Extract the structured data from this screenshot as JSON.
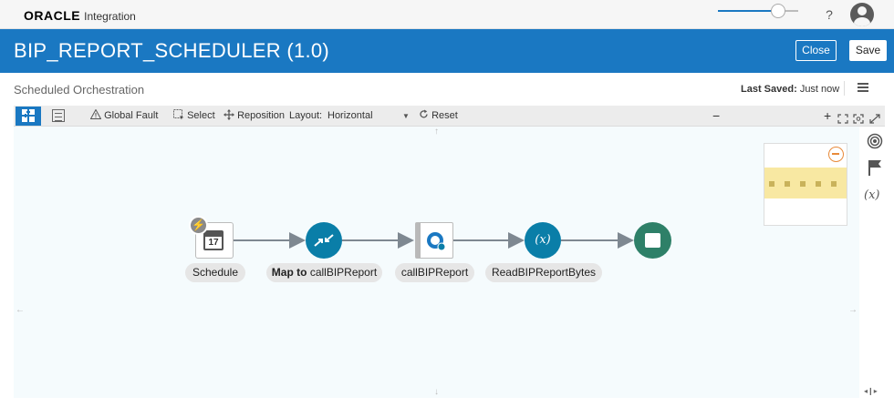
{
  "topbar": {
    "brand": "ORACLE",
    "product": "Integration",
    "help_icon": "?"
  },
  "header": {
    "title": "BIP_REPORT_SCHEDULER (1.0)",
    "close_label": "Close",
    "save_label": "Save"
  },
  "subheader": {
    "title": "Scheduled Orchestration",
    "last_saved_label": "Last Saved:",
    "last_saved_value": "Just now"
  },
  "toolbar": {
    "global_fault": "Global Fault",
    "select": "Select",
    "reposition": "Reposition",
    "layout_label": "Layout:",
    "layout_value": "Horizontal",
    "reset": "Reset",
    "zoom_minus": "−",
    "zoom_plus": "+",
    "zoom_level": 0.75
  },
  "flow": {
    "nodes": [
      {
        "id": "schedule",
        "label": "Schedule",
        "icon": "calendar-icon",
        "calendar_day": "17"
      },
      {
        "id": "map",
        "label_bold": "Map to",
        "label": "callBIPReport",
        "icon": "map-arrows-icon"
      },
      {
        "id": "invoke",
        "label": "callBIPReport",
        "icon": "invoke-adapter-icon"
      },
      {
        "id": "assign",
        "label": "ReadBIPReportBytes",
        "icon": "variable-icon",
        "icon_text": "(x)"
      },
      {
        "id": "end",
        "label": "",
        "icon": "stop-icon"
      }
    ]
  },
  "rail": {
    "variables_icon_text": "(x)"
  },
  "colors": {
    "brand_blue": "#1a78c2",
    "node_teal": "#0a7ea8",
    "end_green": "#2e8068",
    "canvas_bg": "#f5fbfd"
  }
}
